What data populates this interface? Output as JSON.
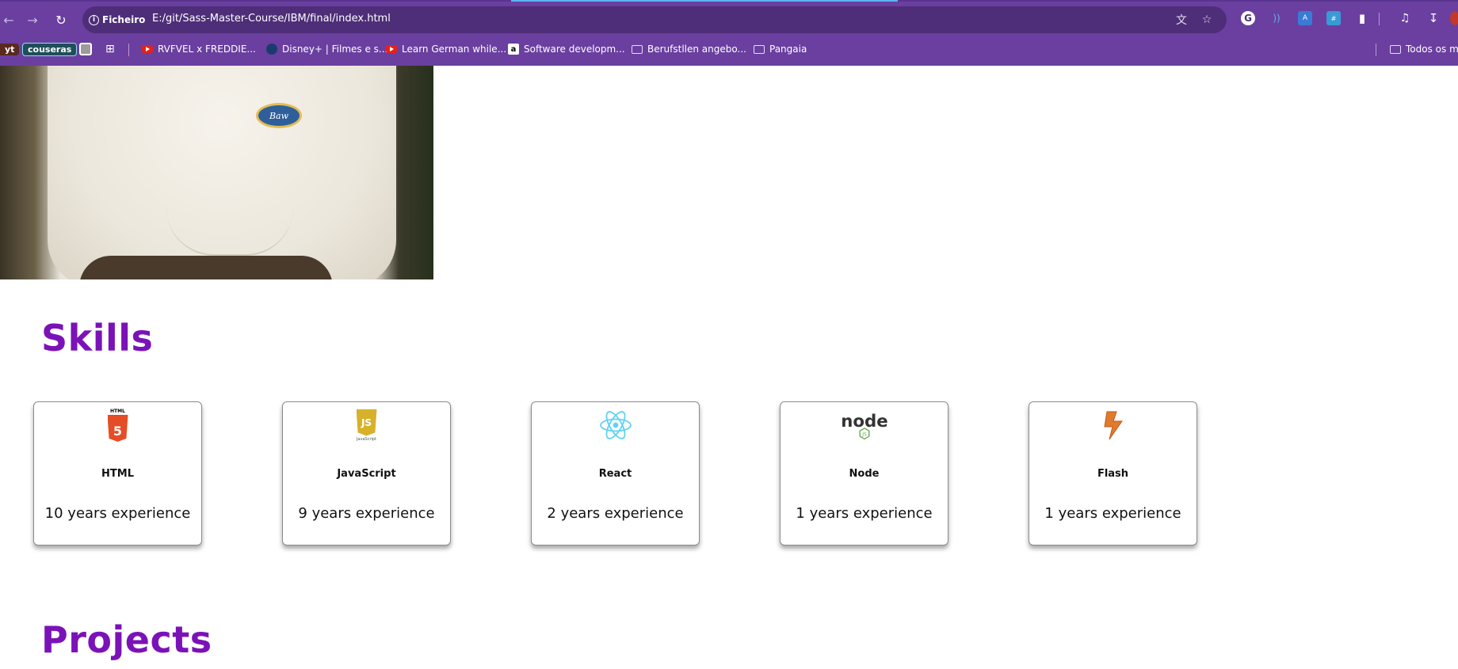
{
  "browser": {
    "site_chip": "Ficheiro",
    "url": "E:/git/Sass-Master-Course/IBM/final/index.html",
    "bookmarks": [
      {
        "label": "yt",
        "type": "chip"
      },
      {
        "label": "couseras",
        "type": "chip"
      },
      {
        "label": "RVFVEL x FREDDIE...",
        "type": "youtube"
      },
      {
        "label": "Disney+ | Filmes e s...",
        "type": "disney"
      },
      {
        "label": "Learn German while...",
        "type": "youtube"
      },
      {
        "label": "Software developm...",
        "type": "amazon"
      },
      {
        "label": "Berufstllen angebo...",
        "type": "folder"
      },
      {
        "label": "Pangaia",
        "type": "folder"
      }
    ],
    "other_bookmarks": "Todos os ma",
    "accent_color": "#6a3fa0"
  },
  "hero": {
    "badge_text": "Baw"
  },
  "skills": {
    "title": "Skills",
    "items": [
      {
        "name": "HTML",
        "experience": "10 years experience",
        "icon": "html5-icon",
        "logo_caption": "HTML"
      },
      {
        "name": "JavaScript",
        "experience": "9 years experience",
        "icon": "javascript-icon",
        "logo_caption": "JavaScript"
      },
      {
        "name": "React",
        "experience": "2 years experience",
        "icon": "react-icon"
      },
      {
        "name": "Node",
        "experience": "1 years experience",
        "icon": "node-icon",
        "logo_text": "node"
      },
      {
        "name": "Flash",
        "experience": "1 years experience",
        "icon": "flash-icon"
      }
    ]
  },
  "projects": {
    "title": "Projects"
  },
  "colors": {
    "heading": "#7b12b8"
  }
}
